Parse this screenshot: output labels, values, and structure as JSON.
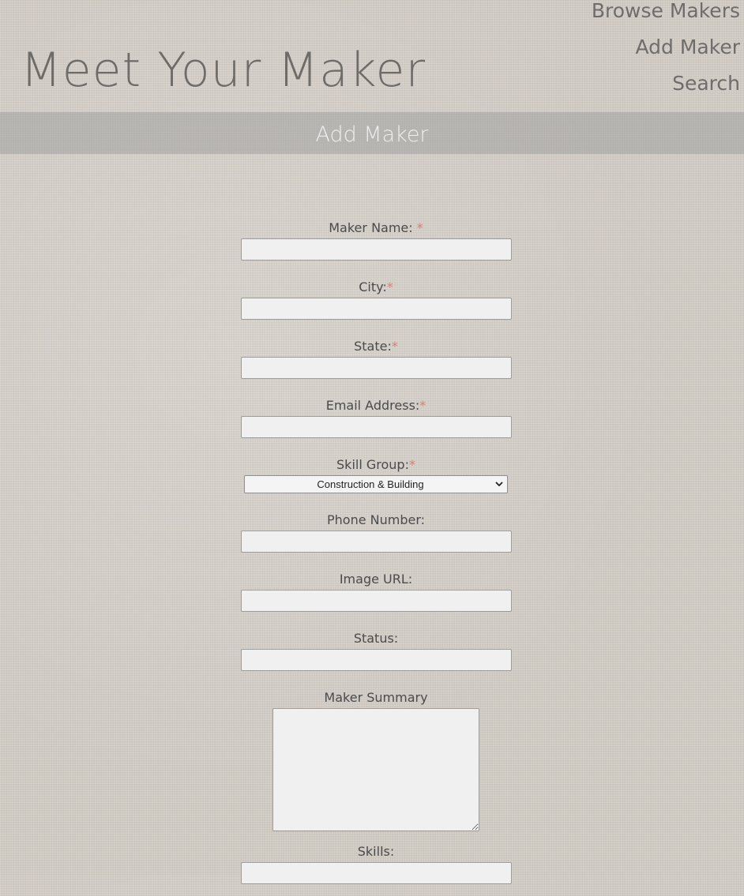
{
  "site": {
    "title": "Meet Your Maker"
  },
  "nav": {
    "items": [
      "Browse Makers",
      "Add Maker",
      "Search"
    ]
  },
  "page": {
    "heading": "Add Maker"
  },
  "form": {
    "required_marker": "*",
    "fields": [
      {
        "label": "Maker Name: ",
        "required": true,
        "value": ""
      },
      {
        "label": "City:",
        "required": true,
        "value": ""
      },
      {
        "label": "State:",
        "required": true,
        "value": ""
      },
      {
        "label": "Email Address:",
        "required": true,
        "value": ""
      },
      {
        "label": "Skill Group:",
        "required": true,
        "selected": "Construction & Building"
      },
      {
        "label": "Phone Number:",
        "required": false,
        "value": ""
      },
      {
        "label": "Image URL:",
        "required": false,
        "value": ""
      },
      {
        "label": "Status:",
        "required": false,
        "value": ""
      },
      {
        "label": "Maker Summary",
        "required": false,
        "value": ""
      },
      {
        "label": "Skills:",
        "required": false,
        "value": ""
      }
    ]
  },
  "colors": {
    "required_marker": "#e07b74",
    "banner_text": "#eeeeee",
    "title_text": "#6e6c69"
  }
}
